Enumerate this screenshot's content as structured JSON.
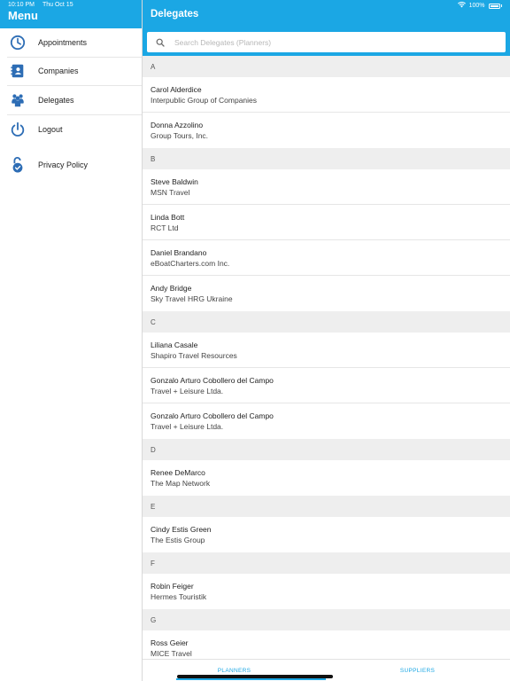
{
  "status_bar": {
    "time": "10:10 PM",
    "date": "Thu Oct 15",
    "battery": "100%"
  },
  "sidebar": {
    "title": "Menu",
    "items": [
      {
        "label": "Appointments",
        "icon": "clock-icon"
      },
      {
        "label": "Companies",
        "icon": "address-book-icon"
      },
      {
        "label": "Delegates",
        "icon": "people-icon"
      },
      {
        "label": "Logout",
        "icon": "power-icon"
      },
      {
        "label": "Privacy Policy",
        "icon": "unlocked-shield-icon"
      }
    ]
  },
  "main": {
    "title": "Delegates",
    "search_placeholder": "Search Delegates (Planners)",
    "sections": [
      {
        "letter": "A",
        "rows": [
          {
            "name": "Carol Alderdice",
            "company": "Interpublic Group of Companies"
          },
          {
            "name": "Donna Azzolino",
            "company": "Group Tours, Inc."
          }
        ]
      },
      {
        "letter": "B",
        "rows": [
          {
            "name": "Steve Baldwin",
            "company": "MSN Travel"
          },
          {
            "name": "Linda Bott",
            "company": "RCT Ltd"
          },
          {
            "name": "Daniel Brandano",
            "company": "eBoatCharters.com Inc."
          },
          {
            "name": "Andy Bridge",
            "company": "Sky Travel HRG Ukraine"
          }
        ]
      },
      {
        "letter": "C",
        "rows": [
          {
            "name": "Liliana Casale",
            "company": "Shapiro Travel Resources"
          },
          {
            "name": "Gonzalo Arturo Cobollero del Campo",
            "company": "Travel + Leisure Ltda."
          },
          {
            "name": "Gonzalo Arturo Cobollero del Campo",
            "company": "Travel + Leisure Ltda."
          }
        ]
      },
      {
        "letter": "D",
        "rows": [
          {
            "name": "Renee DeMarco",
            "company": "The Map Network"
          }
        ]
      },
      {
        "letter": "E",
        "rows": [
          {
            "name": "Cindy Estis Green",
            "company": "The Estis Group"
          }
        ]
      },
      {
        "letter": "F",
        "rows": [
          {
            "name": "Robin Feiger",
            "company": "Hermes Touristik"
          }
        ]
      },
      {
        "letter": "G",
        "rows": [
          {
            "name": "Ross Geier",
            "company": "MICE Travel"
          }
        ]
      }
    ]
  },
  "tabs": {
    "planners": "PLANNERS",
    "suppliers": "SUPPLIERS",
    "selected": "PLANNERS"
  },
  "colors": {
    "accent": "#1ba7e4",
    "icon": "#2d6db5"
  }
}
